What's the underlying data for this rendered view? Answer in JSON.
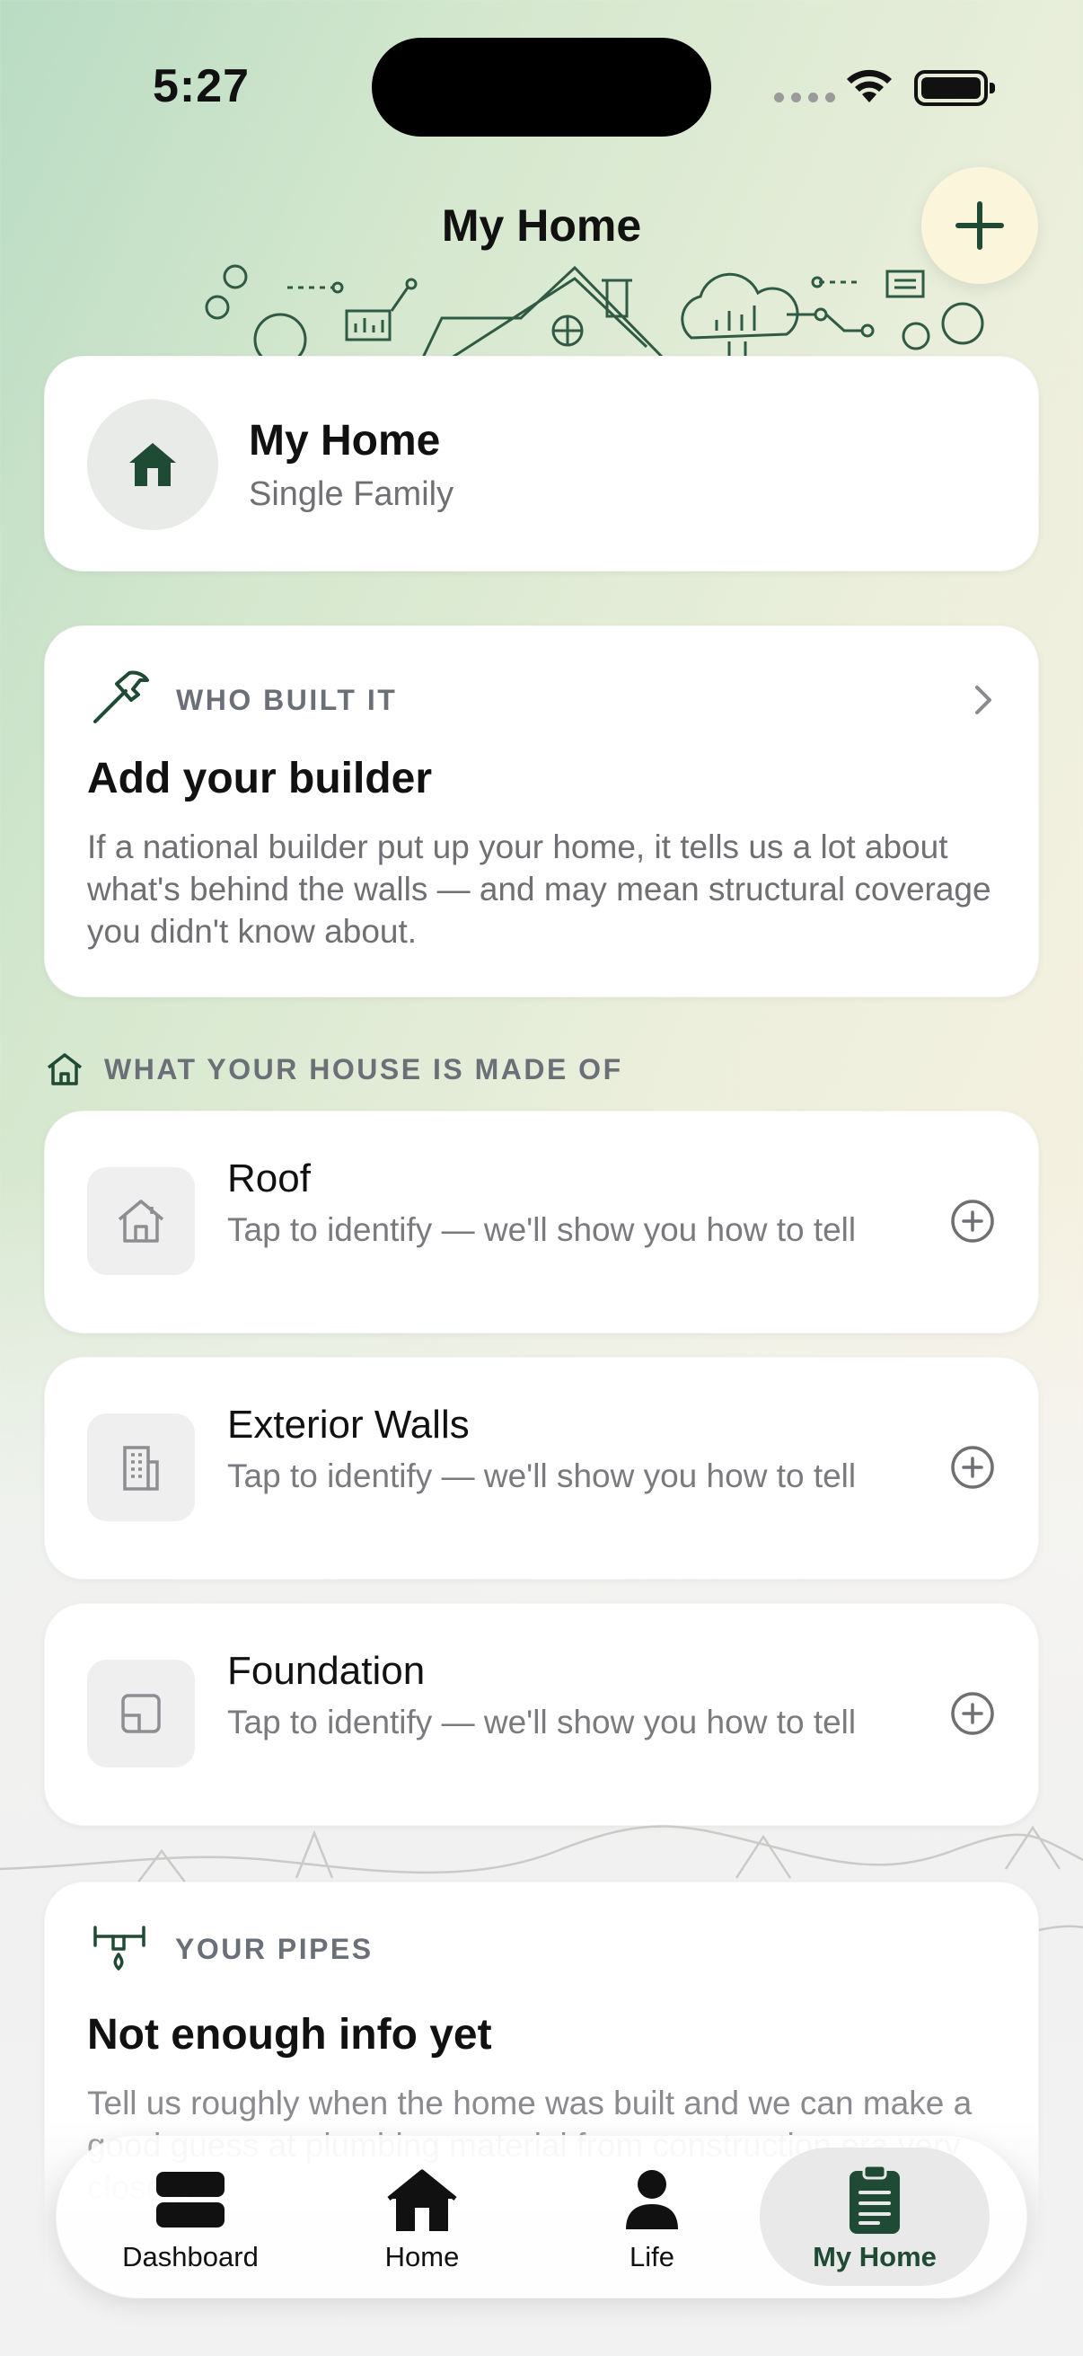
{
  "status_bar": {
    "time": "5:27"
  },
  "header": {
    "title": "My Home"
  },
  "home": {
    "name": "My Home",
    "type": "Single Family"
  },
  "builder": {
    "eyebrow": "WHO BUILT IT",
    "title": "Add your builder",
    "description": "If a national builder put up your home, it tells us a lot about what's behind the walls — and may mean structural coverage you didn't know about."
  },
  "materials": {
    "section_title": "WHAT YOUR HOUSE IS MADE OF",
    "items": [
      {
        "name": "Roof",
        "hint": "Tap to identify — we'll show you how to tell"
      },
      {
        "name": "Exterior Walls",
        "hint": "Tap to identify — we'll show you how to tell"
      },
      {
        "name": "Foundation",
        "hint": "Tap to identify — we'll show you how to tell"
      }
    ]
  },
  "pipes": {
    "eyebrow": "YOUR PIPES",
    "title": "Not enough info yet",
    "description": "Tell us roughly when the home was built and we can make a good guess at plumbing material from construction era very closely."
  },
  "tabs": [
    {
      "label": "Dashboard",
      "icon": "dashboard-icon",
      "active": false
    },
    {
      "label": "Home",
      "icon": "house-icon",
      "active": false
    },
    {
      "label": "Life",
      "icon": "person-icon",
      "active": false
    },
    {
      "label": "My Home",
      "icon": "clipboard-icon",
      "active": true
    }
  ],
  "colors": {
    "accent": "#1f4a34",
    "background_green": "#b9dcc3",
    "background_cream": "#f7f1e1"
  }
}
